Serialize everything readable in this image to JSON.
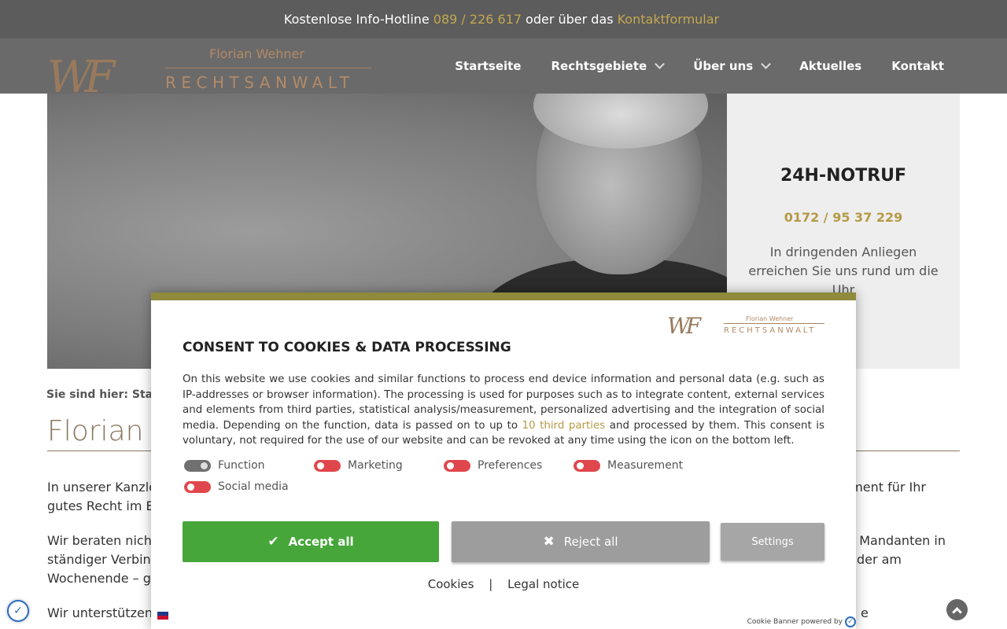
{
  "topbar": {
    "prefix": "Kostenlose Info-Hotline",
    "hotline": "089 / 226 617",
    "middle": "oder über das",
    "contact_link": "Kontaktformular"
  },
  "logo": {
    "monogram": "WF",
    "name": "Florian Wehner",
    "title": "RECHTSANWALT"
  },
  "nav": {
    "items": [
      {
        "label": "Startseite",
        "has_dropdown": false
      },
      {
        "label": "Rechtsgebiete",
        "has_dropdown": true
      },
      {
        "label": "Über uns",
        "has_dropdown": true
      },
      {
        "label": "Aktuelles",
        "has_dropdown": false
      },
      {
        "label": "Kontakt",
        "has_dropdown": false
      }
    ]
  },
  "notruf": {
    "heading": "24H-NOTRUF",
    "phone": "0172 / 95 37 229",
    "text": "In dringenden Anliegen erreichen Sie uns rund um die Uhr"
  },
  "breadcrumb": "Sie sind hier: Startse",
  "page_title": "Florian W",
  "paragraphs": [
    {
      "left": "In unserer Kanzlei",
      "right": "ment für Ihr",
      "left2": "gutes Recht im Ein"
    },
    {
      "left": "Wir beraten nicht",
      "right": "n Mandanten in",
      "left2": "ständiger Verbind",
      "right2": "oder am",
      "left3": "Wochenende – ge"
    },
    {
      "left": "Wir unterstützen",
      "right": "e"
    }
  ],
  "banner": {
    "title": "CONSENT TO COOKIES & DATA PROCESSING",
    "desc_1": "On this website we use cookies and similar functions to process end device information and personal data (e.g. such as IP-addresses or browser information). The processing is used for purposes such as to integrate content, external services and elements from third parties, statistical analysis/measurement, personalized advertising and the integration of social media. Depending on the function, data is passed on to up to",
    "desc_link": "10 third parties",
    "desc_2": "and processed by them. This consent is voluntary, not required for the use of our website and can be revoked at any time using the icon on the bottom left.",
    "toggles": [
      {
        "label": "Function",
        "state": "fixed"
      },
      {
        "label": "Marketing",
        "state": "off"
      },
      {
        "label": "Preferences",
        "state": "off"
      },
      {
        "label": "Measurement",
        "state": "off"
      },
      {
        "label": "Social media",
        "state": "off"
      }
    ],
    "accept_label": "Accept all",
    "reject_label": "Reject all",
    "settings_label": "Settings",
    "cookies_link": "Cookies",
    "separator": "|",
    "legal_link": "Legal notice",
    "powered_by": "Cookie Banner powered by"
  },
  "colors": {
    "gold": "#c4a752",
    "accept_green": "#46a63a",
    "toggle_red": "#e0474c",
    "banner_top": "#8f8a3c"
  },
  "icons": [
    "chevron-down-icon",
    "checkmark-icon",
    "close-icon",
    "flag-icon",
    "consent-icon",
    "arrow-up-icon"
  ]
}
